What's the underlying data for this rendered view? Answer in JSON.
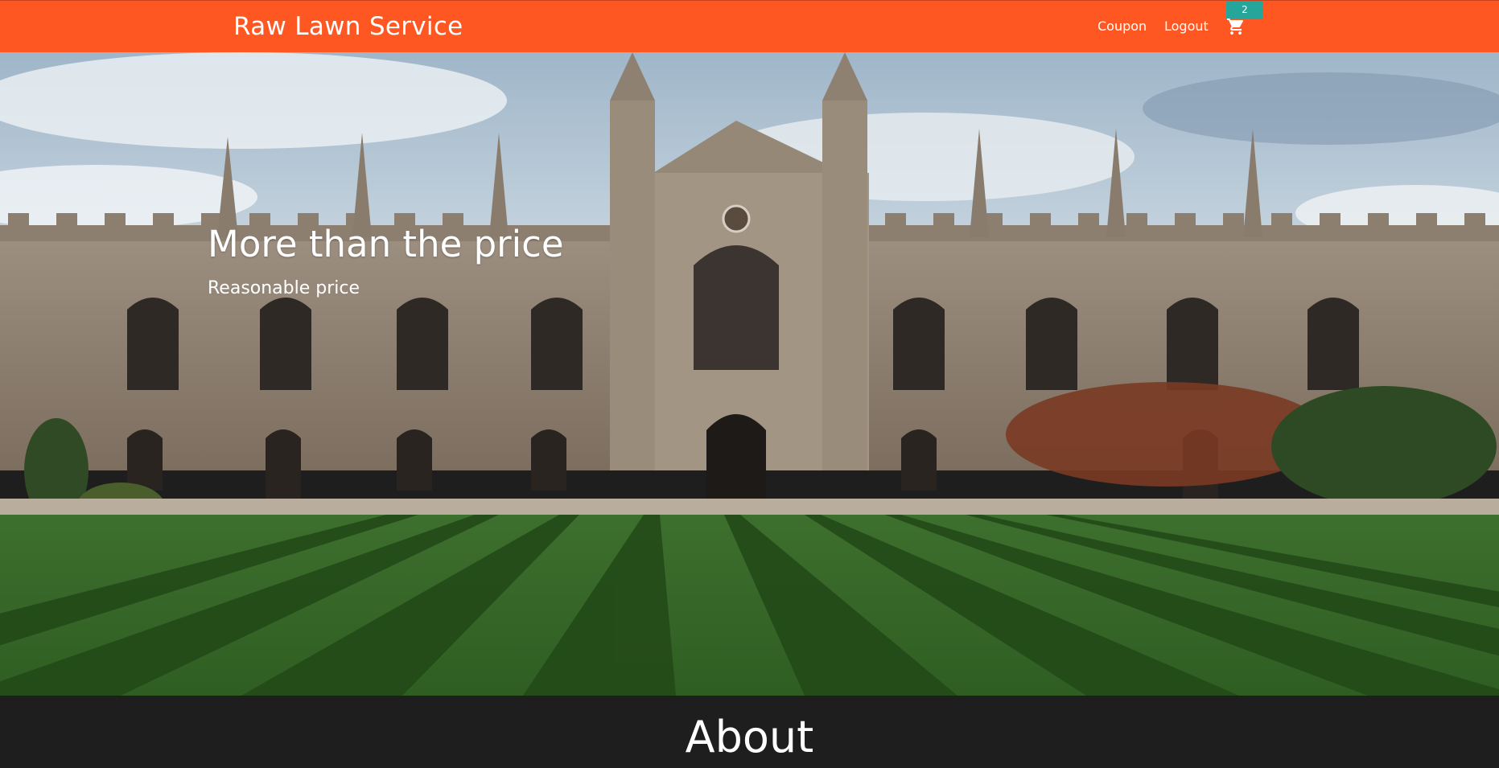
{
  "navbar": {
    "brand": "Raw Lawn Service",
    "links": [
      {
        "label": "Coupon"
      },
      {
        "label": "Logout"
      }
    ],
    "cart": {
      "icon": "shopping-cart-icon",
      "count": "2"
    },
    "color": "#ff5722",
    "badge_color": "#26a69a"
  },
  "hero": {
    "title": "More than the price",
    "subtitle": "Reasonable price",
    "image": "college-courtyard-lawn"
  },
  "about": {
    "title": "About"
  }
}
